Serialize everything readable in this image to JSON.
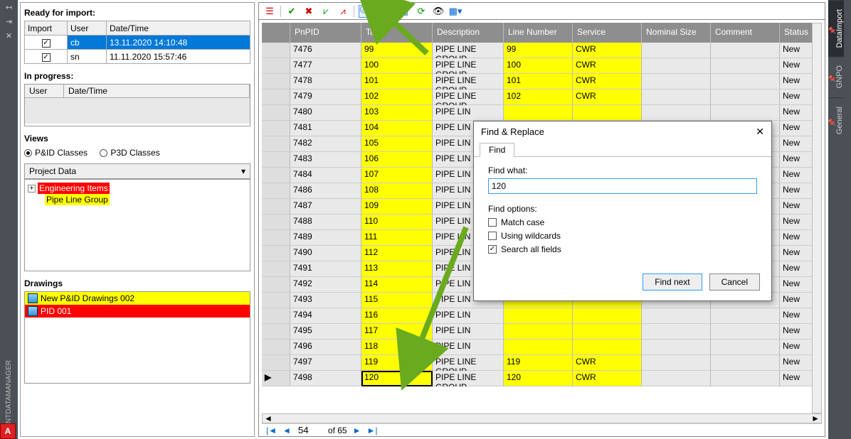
{
  "leftbar": {
    "label": "PLANTDATAMANAGER",
    "bottom_badge": "A"
  },
  "left": {
    "ready_label": "Ready for import:",
    "import_head": {
      "c1": "Import",
      "c2": "User",
      "c3": "Date/Time"
    },
    "imports": [
      {
        "user": "cb",
        "dt": "13.11.2020 14:10:48",
        "selected": true
      },
      {
        "user": "sn",
        "dt": "11.11.2020 15:57:46",
        "selected": false
      }
    ],
    "progress_label": "In progress:",
    "progress_head": {
      "c1": "User",
      "c2": "Date/Time"
    },
    "views_label": "Views",
    "radio_pid": "P&ID Classes",
    "radio_p3d": "P3D Classes",
    "combo": "Project Data",
    "tree": {
      "root": "Engineering Items",
      "child": "Pipe Line Group"
    },
    "drawings_label": "Drawings",
    "drawings": [
      {
        "name": "New P&ID Drawings 002",
        "cls": "yellow"
      },
      {
        "name": "PID 001",
        "cls": "red"
      }
    ]
  },
  "grid": {
    "head": {
      "pnpid": "PnPID",
      "tag": "Tag",
      "desc": "Description",
      "line": "Line Number",
      "srv": "Service",
      "nom": "Nominal Size",
      "com": "Comment",
      "status": "Status"
    },
    "rows": [
      {
        "p": "7476",
        "t": "99",
        "d": "PIPE LINE GROUP",
        "l": "99",
        "s": "CWR",
        "st": "New"
      },
      {
        "p": "7477",
        "t": "100",
        "d": "PIPE LINE GROUP",
        "l": "100",
        "s": "CWR",
        "st": "New"
      },
      {
        "p": "7478",
        "t": "101",
        "d": "PIPE LINE GROUP",
        "l": "101",
        "s": "CWR",
        "st": "New"
      },
      {
        "p": "7479",
        "t": "102",
        "d": "PIPE LINE GROUP",
        "l": "102",
        "s": "CWR",
        "st": "New"
      },
      {
        "p": "7480",
        "t": "103",
        "d": "PIPE LIN",
        "l": "",
        "s": "",
        "st": "New"
      },
      {
        "p": "7481",
        "t": "104",
        "d": "PIPE LIN",
        "l": "",
        "s": "",
        "st": "New"
      },
      {
        "p": "7482",
        "t": "105",
        "d": "PIPE LIN",
        "l": "",
        "s": "",
        "st": "New"
      },
      {
        "p": "7483",
        "t": "106",
        "d": "PIPE LIN",
        "l": "",
        "s": "",
        "st": "New"
      },
      {
        "p": "7484",
        "t": "107",
        "d": "PIPE LIN",
        "l": "",
        "s": "",
        "st": "New"
      },
      {
        "p": "7486",
        "t": "108",
        "d": "PIPE LIN",
        "l": "",
        "s": "",
        "st": "New"
      },
      {
        "p": "7487",
        "t": "109",
        "d": "PIPE LIN",
        "l": "",
        "s": "",
        "st": "New"
      },
      {
        "p": "7488",
        "t": "110",
        "d": "PIPE LIN",
        "l": "",
        "s": "",
        "st": "New"
      },
      {
        "p": "7489",
        "t": "111",
        "d": "PIPE LIN",
        "l": "",
        "s": "",
        "st": "New"
      },
      {
        "p": "7490",
        "t": "112",
        "d": "PIPE LIN",
        "l": "",
        "s": "",
        "st": "New"
      },
      {
        "p": "7491",
        "t": "113",
        "d": "PIPE LIN",
        "l": "",
        "s": "",
        "st": "New"
      },
      {
        "p": "7492",
        "t": "114",
        "d": "PIPE LIN",
        "l": "",
        "s": "",
        "st": "New"
      },
      {
        "p": "7493",
        "t": "115",
        "d": "PIPE LIN",
        "l": "",
        "s": "",
        "st": "New"
      },
      {
        "p": "7494",
        "t": "116",
        "d": "PIPE LIN",
        "l": "",
        "s": "",
        "st": "New"
      },
      {
        "p": "7495",
        "t": "117",
        "d": "PIPE LIN",
        "l": "",
        "s": "",
        "st": "New"
      },
      {
        "p": "7496",
        "t": "118",
        "d": "PIPE LIN",
        "l": "",
        "s": "",
        "st": "New"
      },
      {
        "p": "7497",
        "t": "119",
        "d": "PIPE LINE GROUP",
        "l": "119",
        "s": "CWR",
        "st": "New"
      },
      {
        "p": "7498",
        "t": "120",
        "d": "PIPE LINE GROUP",
        "l": "120",
        "s": "CWR",
        "st": "New",
        "found": true,
        "arrow": true
      }
    ],
    "pager": {
      "pos": "54",
      "of": "of 65"
    }
  },
  "dialog": {
    "title": "Find & Replace",
    "tab": "Find",
    "find_what_label": "Find what:",
    "find_value": "120",
    "opts_label": "Find options:",
    "opt_match": "Match case",
    "opt_wild": "Using wildcards",
    "opt_all": "Search all fields",
    "btn_find": "Find next",
    "btn_cancel": "Cancel"
  },
  "right_tabs": [
    "DataImport",
    "GNPO",
    "General"
  ]
}
